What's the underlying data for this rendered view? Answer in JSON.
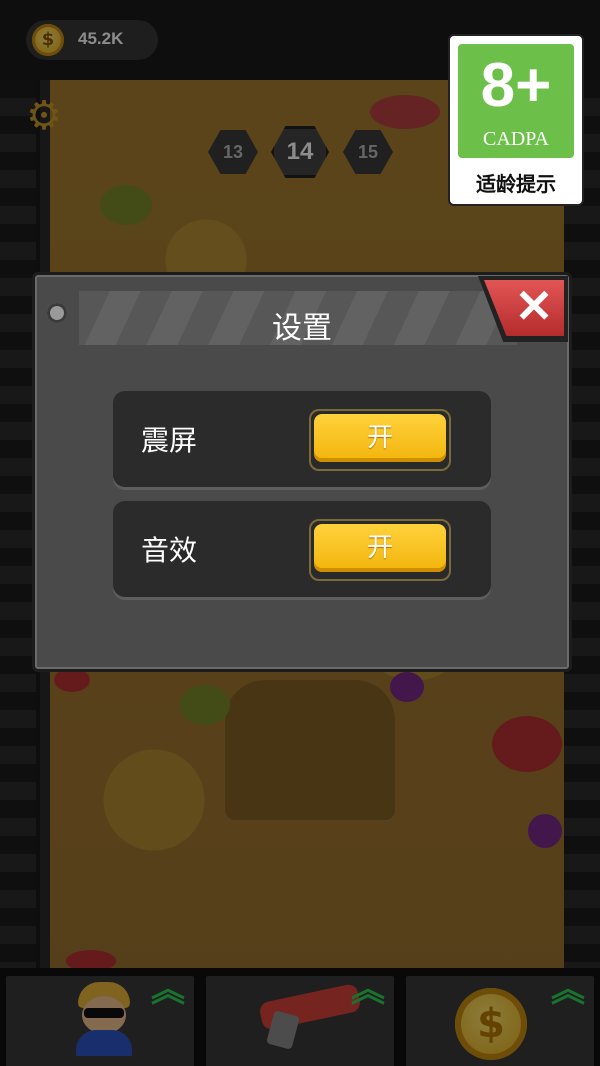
{
  "hud": {
    "coins": "45.2K",
    "coin_symbol": "$"
  },
  "levels": {
    "previous": "13",
    "current": "14",
    "next": "15"
  },
  "age_rating": {
    "age": "8+",
    "org": "CADPA",
    "tip": "适龄提示"
  },
  "settings_dialog": {
    "title": "设置",
    "close_symbol": "✕",
    "rows": [
      {
        "label": "震屏",
        "toggle": "开"
      },
      {
        "label": "音效",
        "toggle": "开"
      }
    ]
  },
  "bottom_bar": {
    "upgrade_symbol": "︽",
    "shop_coin_symbol": "$"
  },
  "icons": [
    "coin-icon",
    "gear-icon",
    "close-icon",
    "hero-icon",
    "gun-icon",
    "upgrade-arrow-icon"
  ],
  "colors": {
    "toggle_on": "#f2b40c",
    "close_button": "#d94040",
    "badge_green": "#6cc04a",
    "upgrade_arrow": "#2fcf55"
  }
}
